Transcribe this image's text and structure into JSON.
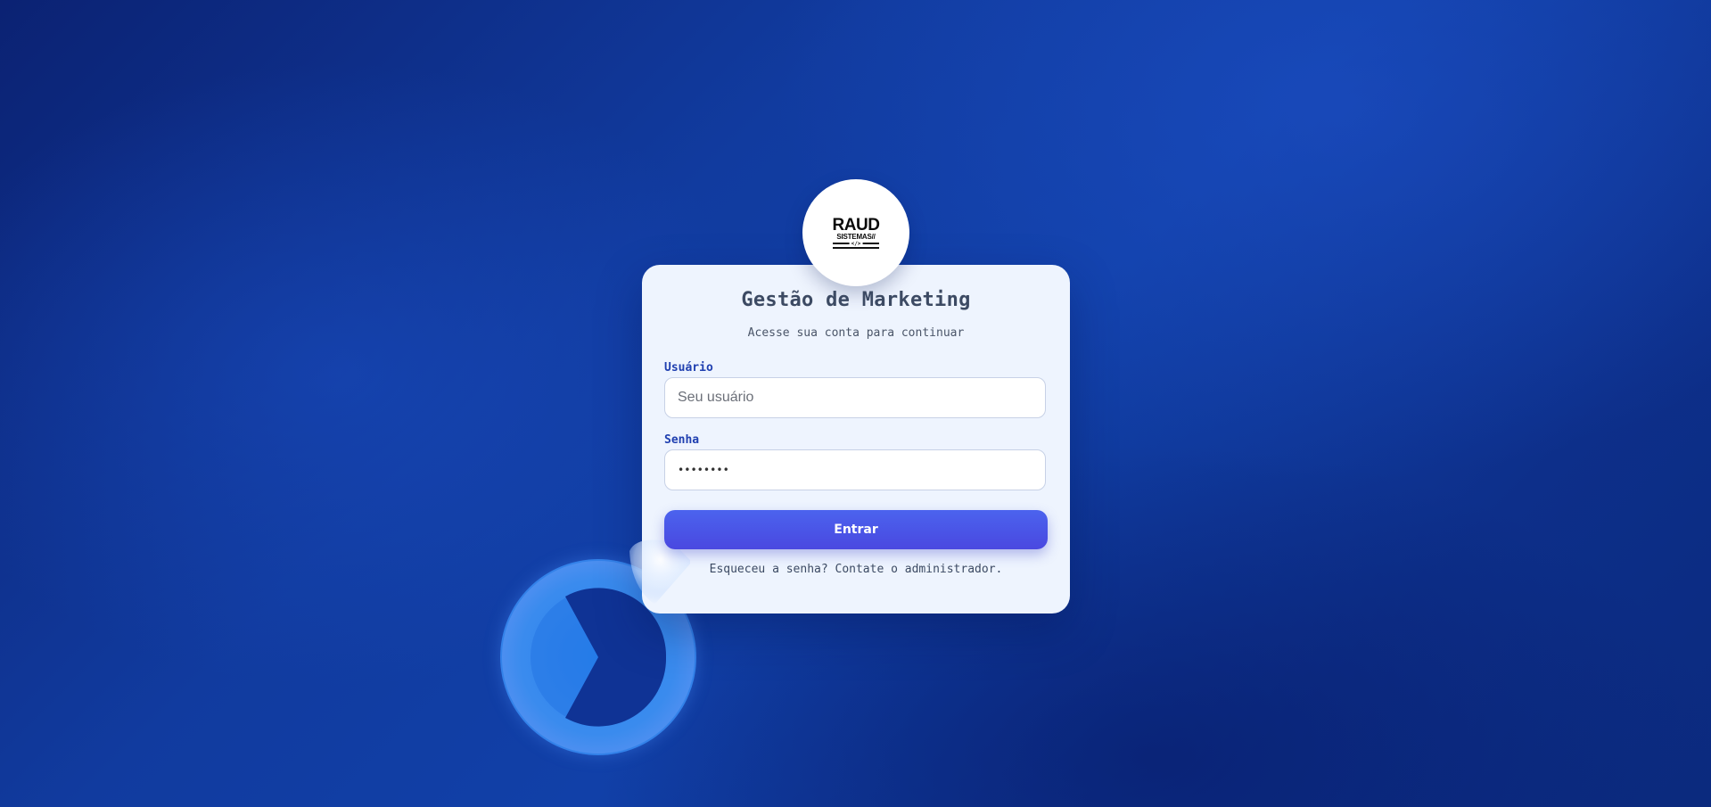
{
  "brand": {
    "logo_main": "RAUD",
    "logo_sub": "SISTEMAS//",
    "logo_code": "</>"
  },
  "login": {
    "title": "Gestão de Marketing",
    "subtitle": "Acesse sua conta para continuar",
    "username_label": "Usuário",
    "username_placeholder": "Seu usuário",
    "username_value": "",
    "password_label": "Senha",
    "password_value": "••••••••",
    "submit_label": "Entrar",
    "forgot_text": "Esqueceu a senha? Contate o administrador."
  },
  "colors": {
    "background": "#113b9f",
    "card": "#eef4fe",
    "accent": "#4a56e8",
    "label": "#1f3fb0",
    "title": "#3c4a63"
  },
  "icons": {
    "decorative_ring": "loading-ring-icon"
  }
}
